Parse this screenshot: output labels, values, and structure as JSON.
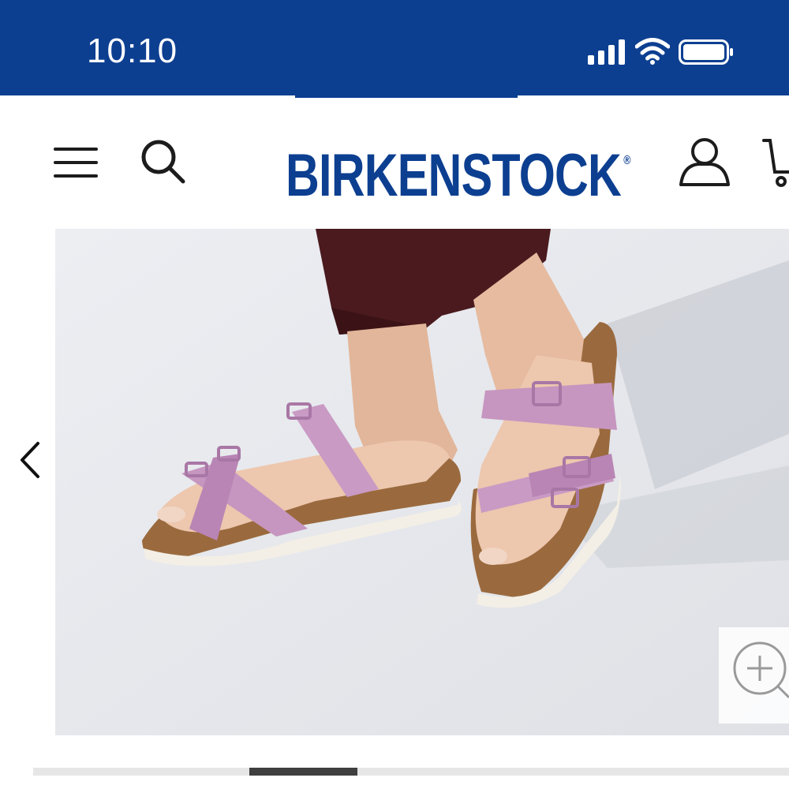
{
  "status_bar": {
    "time": "10:10",
    "icons": [
      "signal-icon",
      "wifi-icon",
      "battery-icon"
    ],
    "background": "#0d3f91"
  },
  "header": {
    "brand": "BIRKENSTOCK",
    "registered_mark": "®",
    "brand_color": "#0d3f91",
    "icons": [
      "menu-icon",
      "search-icon",
      "account-icon",
      "cart-icon"
    ]
  },
  "gallery": {
    "image_subject": "product-photo",
    "controls": [
      "chevron-left-icon",
      "zoom-in-icon"
    ],
    "pager": {
      "total": 7,
      "active_index": 2
    }
  }
}
